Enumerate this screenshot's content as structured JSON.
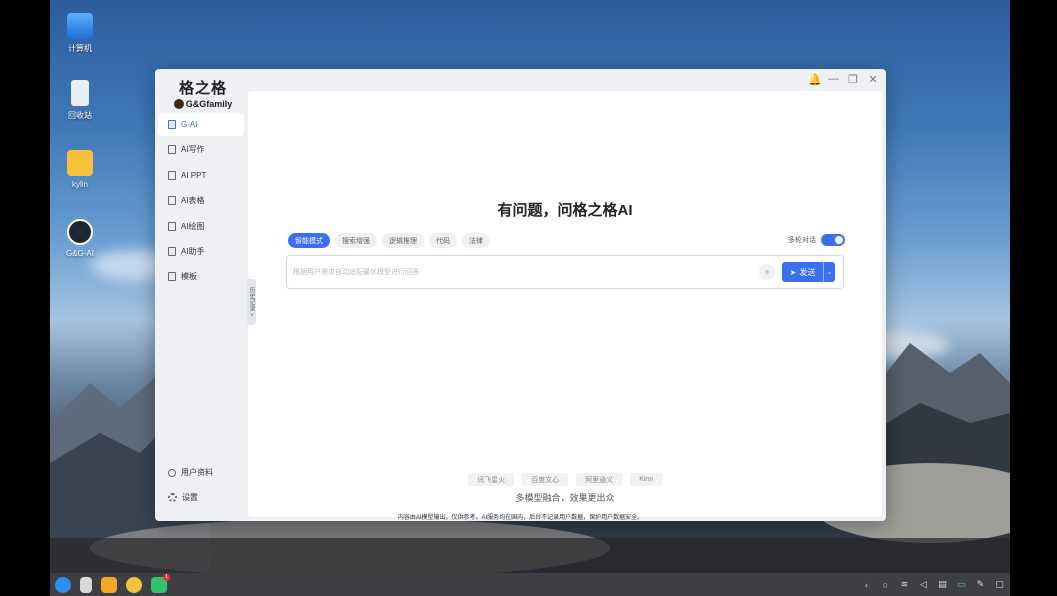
{
  "desktop": {
    "icons": [
      {
        "label": "计算机"
      },
      {
        "label": "回收站"
      },
      {
        "label": "kylin"
      },
      {
        "label": "G&G-AI"
      }
    ]
  },
  "window": {
    "controls": {
      "bell": "🔔",
      "minimize": "—",
      "restore": "❐",
      "close": "✕"
    }
  },
  "brand": {
    "name_cn": "格之格",
    "name_en": "G&Gfamily"
  },
  "sidebar": {
    "items": [
      {
        "label": "G-AI"
      },
      {
        "label": "AI写作"
      },
      {
        "label": "AI PPT"
      },
      {
        "label": "AI表格"
      },
      {
        "label": "AI绘图"
      },
      {
        "label": "AI助手"
      },
      {
        "label": "模板"
      }
    ],
    "bottom": [
      {
        "label": "用户资料"
      },
      {
        "label": "设置"
      }
    ],
    "collapse_label": "历史记录 >"
  },
  "main": {
    "headline": "有问题，问格之格AI",
    "modes": [
      "智能模式",
      "搜索增强",
      "逻辑推理",
      "代码",
      "法律"
    ],
    "multi_turn_label": "多轮对话",
    "multi_turn_on": true,
    "input_placeholder": "根据用户需求自动适配最优模型进行回答",
    "send_label": "发送",
    "models": [
      "讯飞星火",
      "百度文心",
      "阿里通义",
      "Kimi"
    ],
    "tagline": "多模型融合，效果更出众",
    "disclaimer": "内容由AI模型输出，仅供参考。AI服务均在国内，后台不记录用户数据，保护用户数据安全。"
  },
  "colors": {
    "accent": "#3a6ff0"
  }
}
